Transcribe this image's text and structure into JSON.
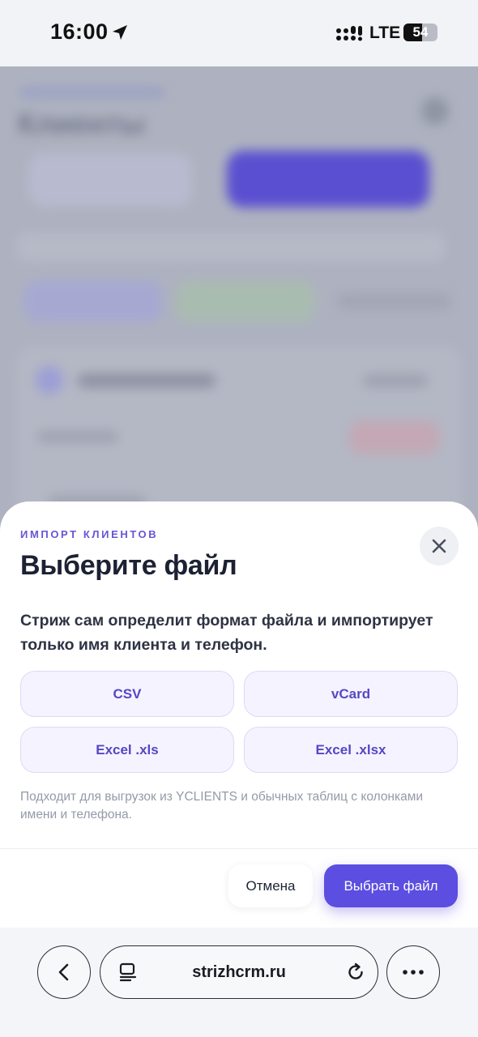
{
  "status_bar": {
    "time": "16:00",
    "network": "LTE",
    "battery": "54",
    "battery_level": 0.54
  },
  "background_app": {
    "title": "Клиенты"
  },
  "sheet": {
    "eyebrow": "ИМПОРТ КЛИЕНТОВ",
    "title": "Выберите файл",
    "description": "Стриж сам определит формат файла и импортирует только имя клиента и телефон.",
    "formats": [
      "CSV",
      "vCard",
      "Excel .xls",
      "Excel .xlsx"
    ],
    "hint": "Подходит для выгрузок из YCLIENTS и обычных таблиц с колонками имени и телефона.",
    "cancel_label": "Отмена",
    "choose_label": "Выбрать файл",
    "accent_color": "#5b4ee0"
  },
  "browser": {
    "url": "strizhcrm.ru"
  }
}
